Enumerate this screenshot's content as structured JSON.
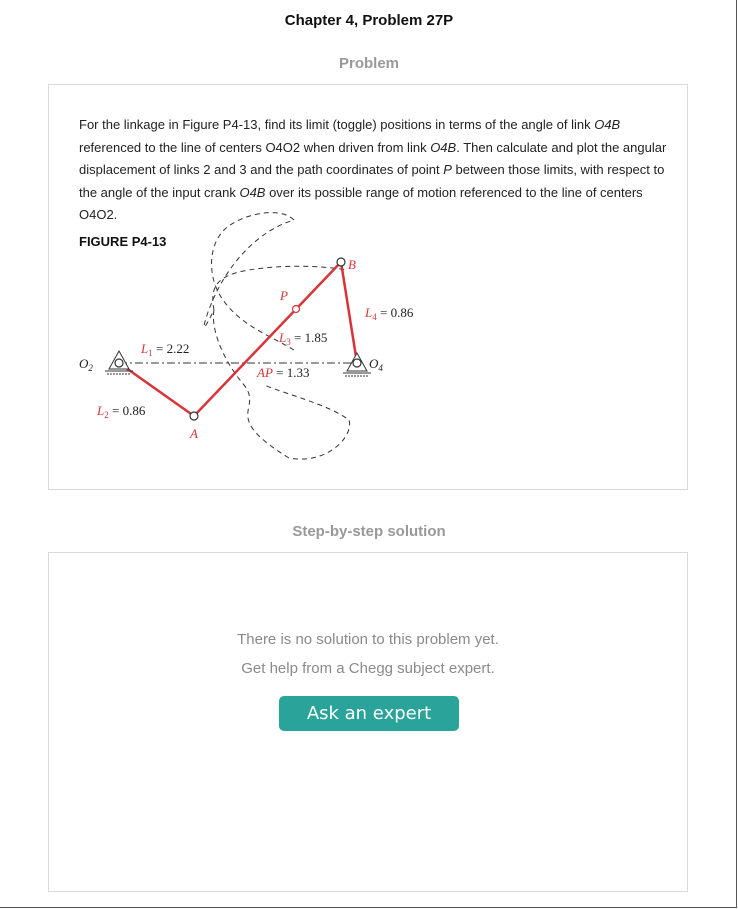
{
  "header": {
    "chapter_title": "Chapter 4, Problem 27P"
  },
  "problem_section": {
    "title": "Problem",
    "text_parts": [
      "For the linkage in Figure P4-13, find its limit (toggle) positions in terms of the angle of link ",
      "O4B",
      " referenced to the line of centers O4O2 when driven from link ",
      "O4B",
      ". Then calculate and plot the angular displacement of links 2 and 3 and the path coordinates of point ",
      "P",
      " between those limits, with respect to the angle of the input crank ",
      "O4B",
      " over its possible range of motion referenced to the line of centers O4O2."
    ],
    "figure_label": "FIGURE P4-13",
    "figure": {
      "labels": {
        "o2": "O",
        "o2_sub": "2",
        "o4": "O",
        "o4_sub": "4",
        "a": "A",
        "b": "B",
        "p": "P",
        "l1": "L",
        "l1_sub": "1",
        "l1_val": " = 2.22",
        "l2": "L",
        "l2_sub": "2",
        "l2_val": " = 0.86",
        "l3": "L",
        "l3_sub": "3",
        "l3_val": " = 1.85",
        "l4": "L",
        "l4_sub": "4",
        "l4_val": " = 0.86",
        "ap": "AP",
        "ap_val": " = 1.33"
      },
      "colors": {
        "link": "#d9343a",
        "label_red": "#d9343a",
        "ink": "#222222"
      }
    }
  },
  "solution_section": {
    "title": "Step-by-step solution",
    "no_solution_line1": "There is no solution to this problem yet.",
    "no_solution_line2": "Get help from a Chegg subject expert.",
    "ask_button_label": "Ask an expert",
    "button_color": "#2aa39b"
  }
}
